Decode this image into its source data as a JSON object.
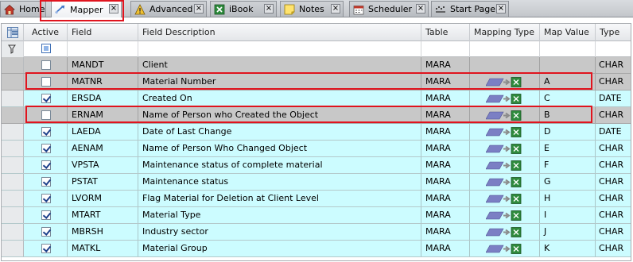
{
  "tabs": [
    {
      "label": "Home",
      "icon": "home-icon",
      "closable": false
    },
    {
      "label": "Mapper",
      "icon": "mapper-icon",
      "closable": true,
      "active": true
    },
    {
      "label": "Advanced",
      "icon": "advanced-icon",
      "closable": true
    },
    {
      "label": "iBook",
      "icon": "ibook-icon",
      "closable": true
    },
    {
      "label": "Notes",
      "icon": "notes-icon",
      "closable": true
    },
    {
      "label": "Scheduler",
      "icon": "scheduler-icon",
      "closable": true
    },
    {
      "label": "Start Page",
      "icon": "start-page-icon",
      "closable": true
    }
  ],
  "grid": {
    "columns": {
      "active": "Active",
      "field": "Field",
      "description": "Field Description",
      "table": "Table",
      "mapping_type": "Mapping Type",
      "map_value": "Map Value",
      "type": "Type"
    },
    "rows": [
      {
        "active": false,
        "field": "MANDT",
        "description": "Client",
        "table": "MARA",
        "mapping": false,
        "map_value": "",
        "type": "CHAR",
        "highlighted": false
      },
      {
        "active": false,
        "field": "MATNR",
        "description": "Material Number",
        "table": "MARA",
        "mapping": true,
        "map_value": "A",
        "type": "CHAR",
        "highlighted": true
      },
      {
        "active": true,
        "field": "ERSDA",
        "description": "Created On",
        "table": "MARA",
        "mapping": true,
        "map_value": "C",
        "type": "DATE",
        "highlighted": false
      },
      {
        "active": false,
        "field": "ERNAM",
        "description": "Name of Person who Created the Object",
        "table": "MARA",
        "mapping": true,
        "map_value": "B",
        "type": "CHAR",
        "highlighted": true
      },
      {
        "active": true,
        "field": "LAEDA",
        "description": "Date of Last Change",
        "table": "MARA",
        "mapping": true,
        "map_value": "D",
        "type": "DATE",
        "highlighted": false
      },
      {
        "active": true,
        "field": "AENAM",
        "description": "Name of Person Who Changed Object",
        "table": "MARA",
        "mapping": true,
        "map_value": "E",
        "type": "CHAR",
        "highlighted": false
      },
      {
        "active": true,
        "field": "VPSTA",
        "description": "Maintenance status of complete material",
        "table": "MARA",
        "mapping": true,
        "map_value": "F",
        "type": "CHAR",
        "highlighted": false
      },
      {
        "active": true,
        "field": "PSTAT",
        "description": "Maintenance status",
        "table": "MARA",
        "mapping": true,
        "map_value": "G",
        "type": "CHAR",
        "highlighted": false
      },
      {
        "active": true,
        "field": "LVORM",
        "description": "Flag Material for Deletion at Client Level",
        "table": "MARA",
        "mapping": true,
        "map_value": "H",
        "type": "CHAR",
        "highlighted": false
      },
      {
        "active": true,
        "field": "MTART",
        "description": "Material Type",
        "table": "MARA",
        "mapping": true,
        "map_value": "I",
        "type": "CHAR",
        "highlighted": false
      },
      {
        "active": true,
        "field": "MBRSH",
        "description": "Industry sector",
        "table": "MARA",
        "mapping": true,
        "map_value": "J",
        "type": "CHAR",
        "highlighted": false
      },
      {
        "active": true,
        "field": "MATKL",
        "description": "Material Group",
        "table": "MARA",
        "mapping": true,
        "map_value": "K",
        "type": "CHAR",
        "highlighted": false
      }
    ]
  },
  "colors": {
    "active_row": "#ccfcff",
    "inactive_row": "#c8c8c8",
    "highlight_box": "#e0141e"
  }
}
